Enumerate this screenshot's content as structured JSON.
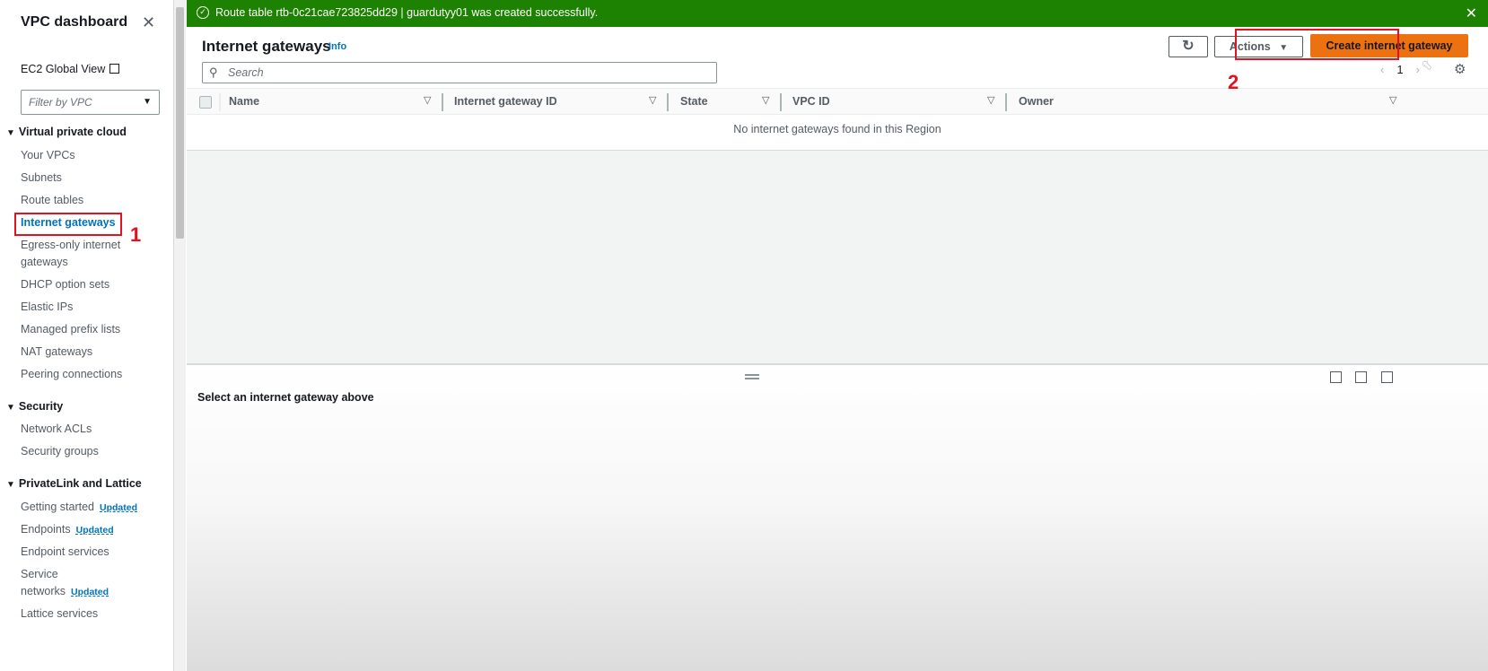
{
  "sidebar": {
    "title": "VPC dashboard",
    "ec2_global_view": "EC2 Global View",
    "filter_placeholder": "Filter by VPC",
    "sections": {
      "vpc": "Virtual private cloud",
      "security": "Security",
      "privatelink": "PrivateLink and Lattice"
    },
    "vpc_items": [
      "Your VPCs",
      "Subnets",
      "Route tables",
      "Internet gateways",
      "Egress-only internet gateways",
      "DHCP option sets",
      "Elastic IPs",
      "Managed prefix lists",
      "NAT gateways",
      "Peering connections"
    ],
    "security_items": [
      "Network ACLs",
      "Security groups"
    ],
    "privatelink_items": [
      "Getting started",
      "Endpoints",
      "Endpoint services",
      "Service networks",
      "Lattice services"
    ],
    "updated_badge": "Updated"
  },
  "annotations": {
    "marker1": "1",
    "marker2": "2"
  },
  "flash": {
    "message": "Route table rtb-0c21cae723825dd29 | guardutyy01 was created successfully."
  },
  "header": {
    "title": "Internet gateways",
    "info": "Info",
    "actions_label": "Actions",
    "create_label": "Create internet gateway",
    "search_placeholder": "Search",
    "page_number": "1"
  },
  "table": {
    "columns": [
      "Name",
      "Internet gateway ID",
      "State",
      "VPC ID",
      "Owner"
    ],
    "empty_message": "No internet gateways found in this Region"
  },
  "details": {
    "message": "Select an internet gateway above"
  },
  "colors": {
    "accent": "#ec7211",
    "success": "#1d8102",
    "link": "#0073bb",
    "annotation": "#e0141e"
  }
}
